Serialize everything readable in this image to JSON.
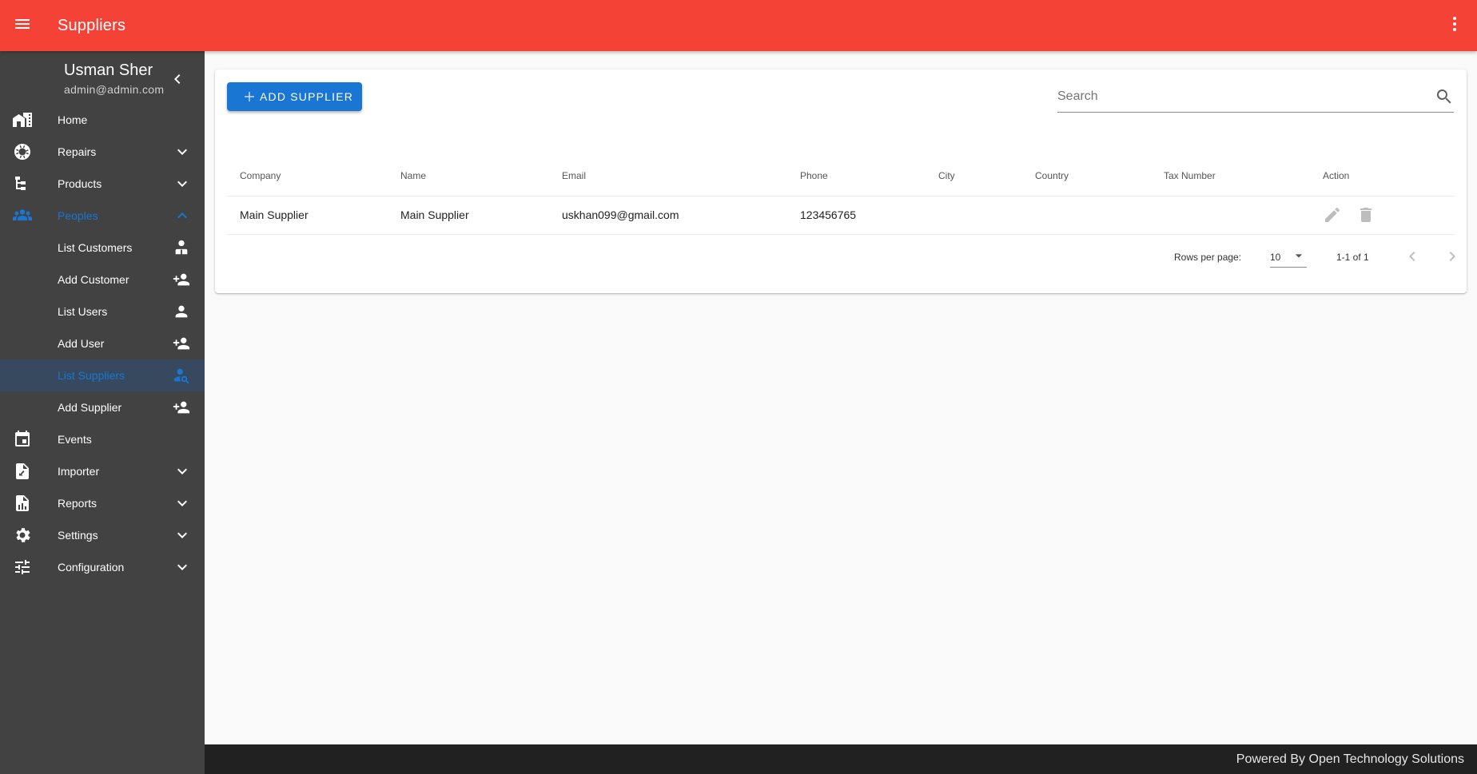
{
  "topbar": {
    "title": "Suppliers",
    "menu_icon": "hamburger-menu-icon",
    "more_icon": "more-vertical-icon"
  },
  "sidebar": {
    "profile": {
      "name": "Usman Sher",
      "email": "admin@admin.com",
      "collapse_icon": "chevron-left-icon"
    },
    "items": [
      {
        "label": "Home",
        "icon": "home-city-icon",
        "expandable": false
      },
      {
        "label": "Repairs",
        "icon": "lifebuoy-icon",
        "expandable": true
      },
      {
        "label": "Products",
        "icon": "file-tree-icon",
        "expandable": true
      },
      {
        "label": "Peoples",
        "icon": "people-group-icon",
        "expandable": true,
        "open": true,
        "children": [
          {
            "label": "List Customers",
            "icon": "account-tie-icon"
          },
          {
            "label": "Add Customer",
            "icon": "person-add-icon"
          },
          {
            "label": "List Users",
            "icon": "person-icon"
          },
          {
            "label": "Add User",
            "icon": "person-add-icon"
          },
          {
            "label": "List Suppliers",
            "icon": "person-search-icon",
            "active": true
          },
          {
            "label": "Add Supplier",
            "icon": "person-add-icon"
          }
        ]
      },
      {
        "label": "Events",
        "icon": "calendar-icon",
        "expandable": false
      },
      {
        "label": "Importer",
        "icon": "file-import-icon",
        "expandable": true
      },
      {
        "label": "Reports",
        "icon": "file-chart-icon",
        "expandable": true
      },
      {
        "label": "Settings",
        "icon": "gear-icon",
        "expandable": true
      },
      {
        "label": "Configuration",
        "icon": "tune-icon",
        "expandable": true
      }
    ]
  },
  "toolbar": {
    "add_label": "ADD SUPPLIER",
    "search_placeholder": "Search",
    "search_value": ""
  },
  "table": {
    "columns": [
      "Company",
      "Name",
      "Email",
      "Phone",
      "City",
      "Country",
      "Tax Number",
      "Action"
    ],
    "rows": [
      {
        "company": "Main Supplier",
        "name": "Main Supplier",
        "email": "uskhan099@gmail.com",
        "phone": "123456765",
        "city": "",
        "country": "",
        "tax_number": "",
        "actions": [
          "edit-icon",
          "delete-icon"
        ]
      }
    ]
  },
  "pagination": {
    "rows_per_page_label": "Rows per page:",
    "rows_per_page": "10",
    "range": "1-1 of 1"
  },
  "footer": {
    "text": "Powered By Open Technology Solutions"
  },
  "colors": {
    "topbar": "#f44336",
    "sidebar": "#424242",
    "sidebar_active": "#37495f",
    "accent": "#1976d2",
    "footer": "#212121"
  }
}
